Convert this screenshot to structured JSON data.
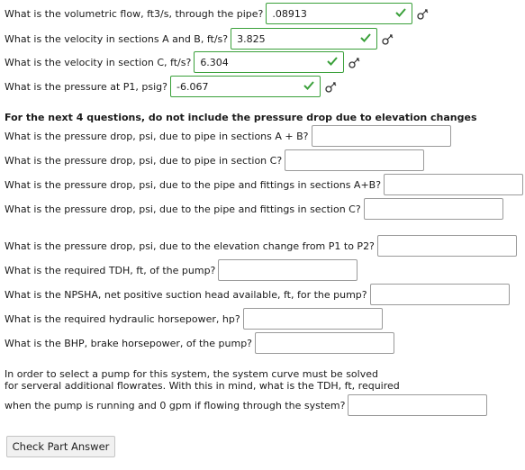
{
  "questions": [
    {
      "q": "What is the volumetric flow, ft3/s, through the pipe?",
      "value": ".08913",
      "correct": true
    },
    {
      "q": "What is the velocity in sections A and B, ft/s?",
      "value": "3.825",
      "correct": true
    },
    {
      "q": "What is the velocity in section C, ft/s?",
      "value": "6.304",
      "correct": true
    },
    {
      "q": "What is the pressure at P1, psig?",
      "value": "-6.067",
      "correct": true
    },
    {
      "q": "What is the pressure drop, psi, due to pipe in sections A + B?",
      "value": ""
    },
    {
      "q": "What is the pressure drop, psi, due to pipe in section C?",
      "value": ""
    },
    {
      "q": "What is the pressure drop, psi, due to the pipe and fittings in sections A+B?",
      "value": ""
    },
    {
      "q": "What is the pressure drop, psi, due to the pipe and fittings in section C?",
      "value": ""
    },
    {
      "q": "What is the pressure drop, psi, due to the elevation change from P1 to P2?",
      "value": ""
    },
    {
      "q": "What is the required TDH, ft, of the pump?",
      "value": ""
    },
    {
      "q": "What is the NPSHA, net positive suction head available, ft, for the pump?",
      "value": ""
    },
    {
      "q": "What is the required hydraulic horsepower, hp?",
      "value": ""
    },
    {
      "q": "What is the BHP, brake horsepower, of the pump?",
      "value": ""
    },
    {
      "q": "when the pump is running and 0 gpm if flowing through the system?",
      "value": ""
    }
  ],
  "note": "For the next 4 questions, do not include the pressure drop due to elevation changes",
  "paragraph": {
    "line1": "In order to select a pump for this system, the system curve must be solved",
    "line2": "for serveral additional flowrates. With this in mind, what is the TDH, ft, required"
  },
  "button_label": "Check Part Answer",
  "colors": {
    "correct": "#3aa03a"
  }
}
